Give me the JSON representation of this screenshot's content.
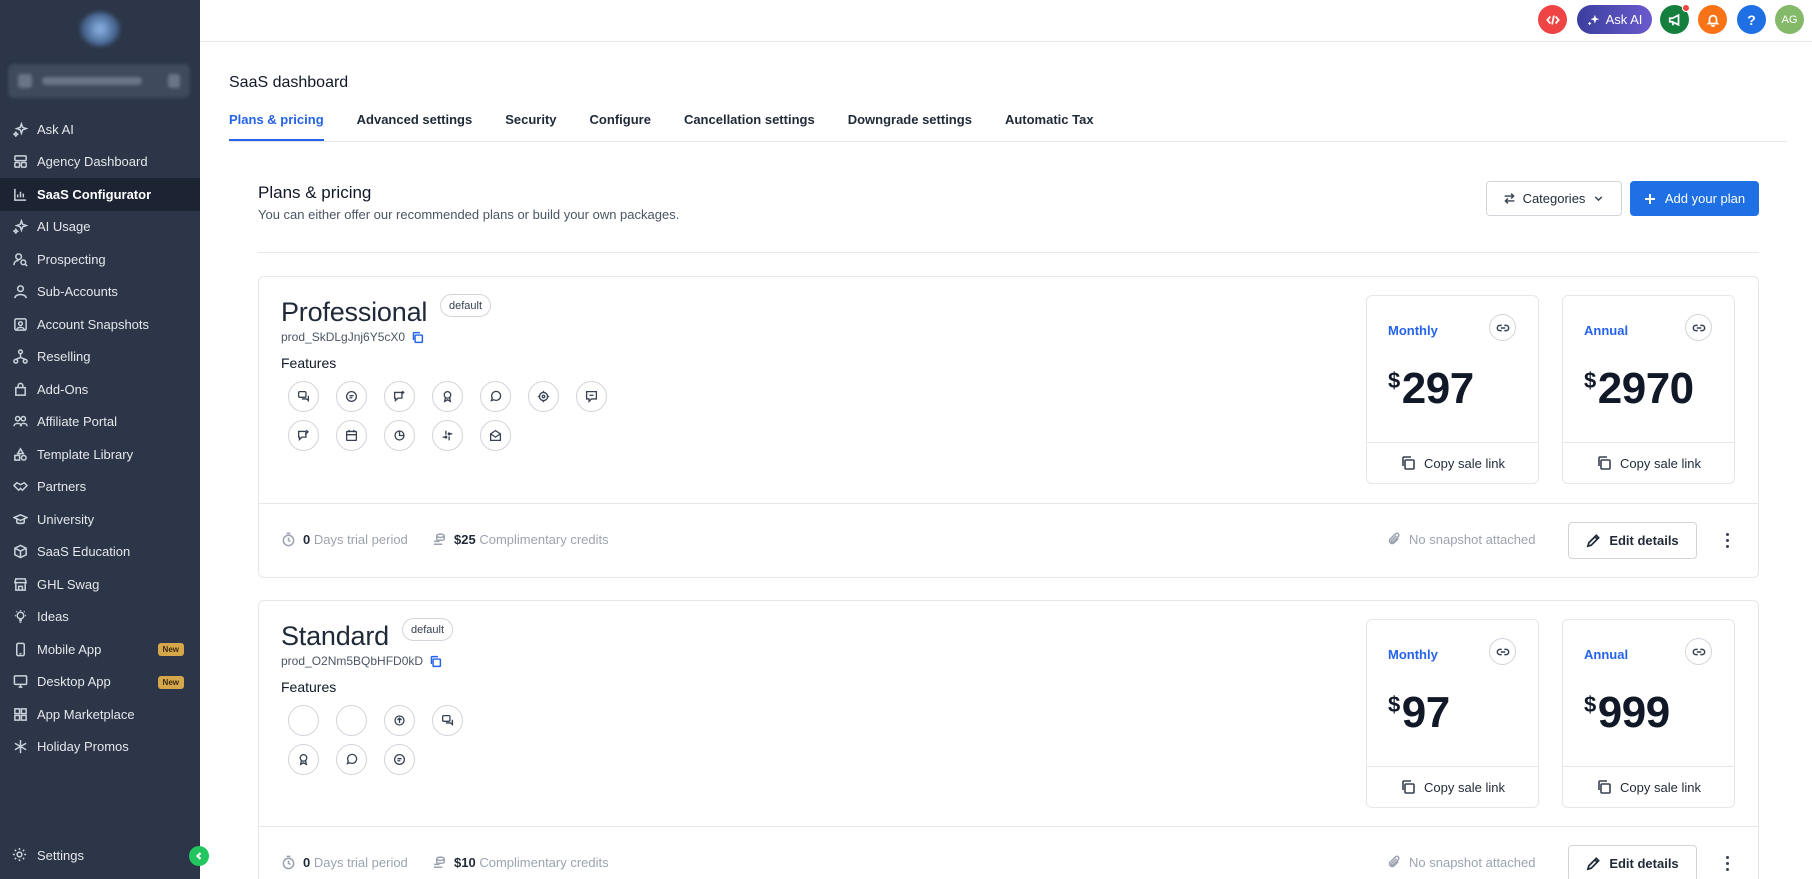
{
  "sidebar": {
    "items": [
      {
        "label": "Ask AI",
        "icon": "sparkle-icon"
      },
      {
        "label": "Agency Dashboard",
        "icon": "dashboard-icon"
      },
      {
        "label": "SaaS Configurator",
        "icon": "chart-icon",
        "active": true
      },
      {
        "label": "AI Usage",
        "icon": "sparkle-icon"
      },
      {
        "label": "Prospecting",
        "icon": "user-search-icon"
      },
      {
        "label": "Sub-Accounts",
        "icon": "user-icon"
      },
      {
        "label": "Account Snapshots",
        "icon": "snapshot-icon"
      },
      {
        "label": "Reselling",
        "icon": "network-icon"
      },
      {
        "label": "Add-Ons",
        "icon": "bag-icon"
      },
      {
        "label": "Affiliate Portal",
        "icon": "users-icon"
      },
      {
        "label": "Template Library",
        "icon": "shapes-icon"
      },
      {
        "label": "Partners",
        "icon": "handshake-icon"
      },
      {
        "label": "University",
        "icon": "graduation-icon"
      },
      {
        "label": "SaaS Education",
        "icon": "box-icon"
      },
      {
        "label": "GHL Swag",
        "icon": "store-icon"
      },
      {
        "label": "Ideas",
        "icon": "bulb-icon"
      },
      {
        "label": "Mobile App",
        "icon": "mobile-icon",
        "badge": "New"
      },
      {
        "label": "Desktop App",
        "icon": "desktop-icon",
        "badge": "New"
      },
      {
        "label": "App Marketplace",
        "icon": "grid-icon"
      },
      {
        "label": "Holiday Promos",
        "icon": "snowflake-icon"
      }
    ],
    "settings_label": "Settings"
  },
  "topbar": {
    "ask_ai_label": "Ask AI",
    "avatar_initials": "AG",
    "help_label": "?"
  },
  "header": {
    "title": "SaaS dashboard",
    "tabs": [
      "Plans & pricing",
      "Advanced settings",
      "Security",
      "Configure",
      "Cancellation settings",
      "Downgrade settings",
      "Automatic Tax"
    ],
    "active_tab": "Plans & pricing"
  },
  "section": {
    "title": "Plans & pricing",
    "subtitle": "You can either offer our recommended plans or build your own packages.",
    "categories_label": "Categories",
    "add_plan_label": "Add your plan"
  },
  "plans": [
    {
      "name": "Professional",
      "badge": "default",
      "id": "prod_SkDLgJnj6Y5cX0",
      "features_label": "Features",
      "monthly_label": "Monthly",
      "monthly_currency": "$",
      "monthly_price": "297",
      "annual_label": "Annual",
      "annual_currency": "$",
      "annual_price": "2970",
      "copy_label": "Copy sale link",
      "trial_days": "0",
      "trial_label": "Days trial period",
      "credits": "$25",
      "credits_label": "Complimentary credits",
      "snapshot_label": "No snapshot attached",
      "edit_label": "Edit details"
    },
    {
      "name": "Standard",
      "badge": "default",
      "id": "prod_O2Nm5BQbHFD0kD",
      "features_label": "Features",
      "monthly_label": "Monthly",
      "monthly_currency": "$",
      "monthly_price": "97",
      "annual_label": "Annual",
      "annual_currency": "$",
      "annual_price": "999",
      "copy_label": "Copy sale link",
      "trial_days": "0",
      "trial_label": "Days trial period",
      "credits": "$10",
      "credits_label": "Complimentary credits",
      "snapshot_label": "No snapshot attached",
      "edit_label": "Edit details"
    }
  ],
  "colors": {
    "sidebar_bg": "#2c3648",
    "accent": "#2563eb",
    "primary_button": "#1f6fe5",
    "new_badge": "#d6a64a"
  }
}
